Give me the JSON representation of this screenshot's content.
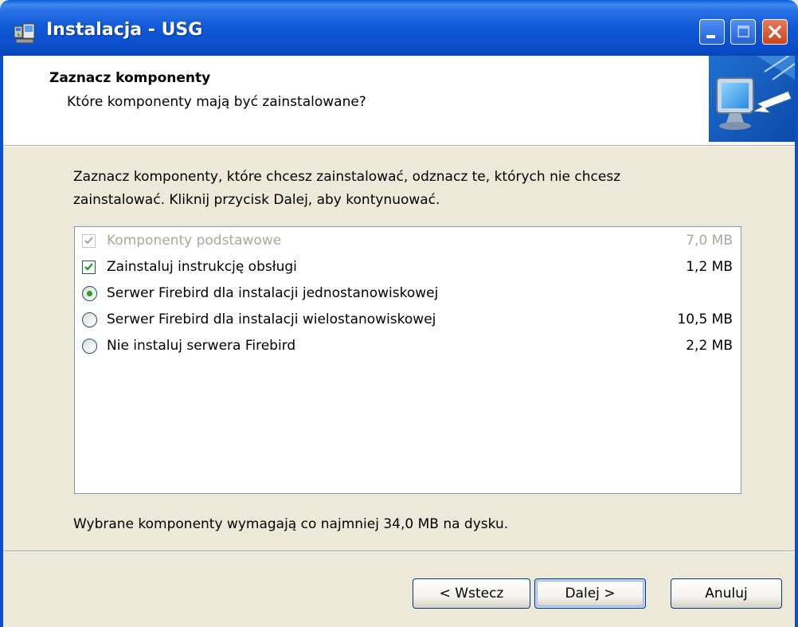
{
  "window": {
    "title": "Instalacja - USG",
    "colors": {
      "titlebar": "#0b4fcf",
      "background": "#ece9d8",
      "close": "#c9451e"
    }
  },
  "header": {
    "title": "Zaznacz komponenty",
    "subtitle": "Które komponenty mają być zainstalowane?"
  },
  "main": {
    "description_line1": "Zaznacz komponenty, które chcesz zainstalować, odznacz te, których nie chcesz",
    "description_line2": "zainstalować. Kliknij przycisk Dalej, aby kontynuować.",
    "components": [
      {
        "label": "Komponenty podstawowe",
        "size": "7,0 MB",
        "control": "checkbox",
        "checked": true,
        "enabled": false
      },
      {
        "label": "Zainstaluj instrukcję obsługi",
        "size": "1,2 MB",
        "control": "checkbox",
        "checked": true,
        "enabled": true
      },
      {
        "label": "Serwer Firebird dla instalacji jednostanowiskowej",
        "size": "",
        "control": "radio",
        "checked": true,
        "enabled": true
      },
      {
        "label": "Serwer Firebird dla instalacji wielostanowiskowej",
        "size": "10,5 MB",
        "control": "radio",
        "checked": false,
        "enabled": true
      },
      {
        "label": "Nie instaluj serwera Firebird",
        "size": "2,2 MB",
        "control": "radio",
        "checked": false,
        "enabled": true
      }
    ],
    "space_required": "Wybrane komponenty wymagają co najmniej 34,0 MB na dysku."
  },
  "buttons": {
    "back": "< Wstecz",
    "next": "Dalej >",
    "cancel": "Anuluj"
  }
}
